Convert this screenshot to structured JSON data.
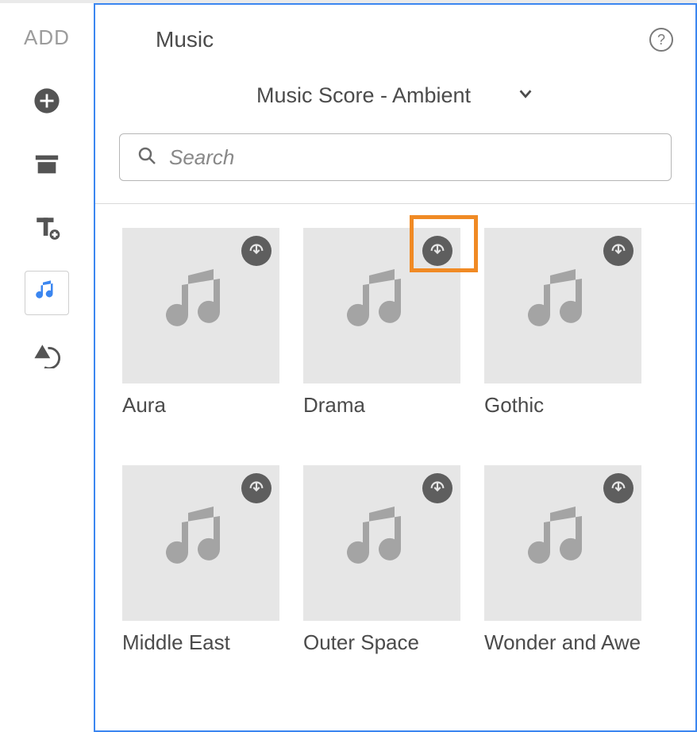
{
  "sidebar": {
    "label": "ADD",
    "items": [
      {
        "name": "add",
        "active": false
      },
      {
        "name": "archive",
        "active": false
      },
      {
        "name": "text",
        "active": false
      },
      {
        "name": "music",
        "active": true
      },
      {
        "name": "transform",
        "active": false
      }
    ]
  },
  "header": {
    "title": "Music"
  },
  "dropdown": {
    "selected": "Music Score - Ambient"
  },
  "search": {
    "placeholder": "Search"
  },
  "highlight_index": 1,
  "tiles": [
    {
      "label": "Aura"
    },
    {
      "label": "Drama"
    },
    {
      "label": "Gothic"
    },
    {
      "label": "Middle East"
    },
    {
      "label": "Outer Space"
    },
    {
      "label": "Wonder and Awe"
    }
  ]
}
